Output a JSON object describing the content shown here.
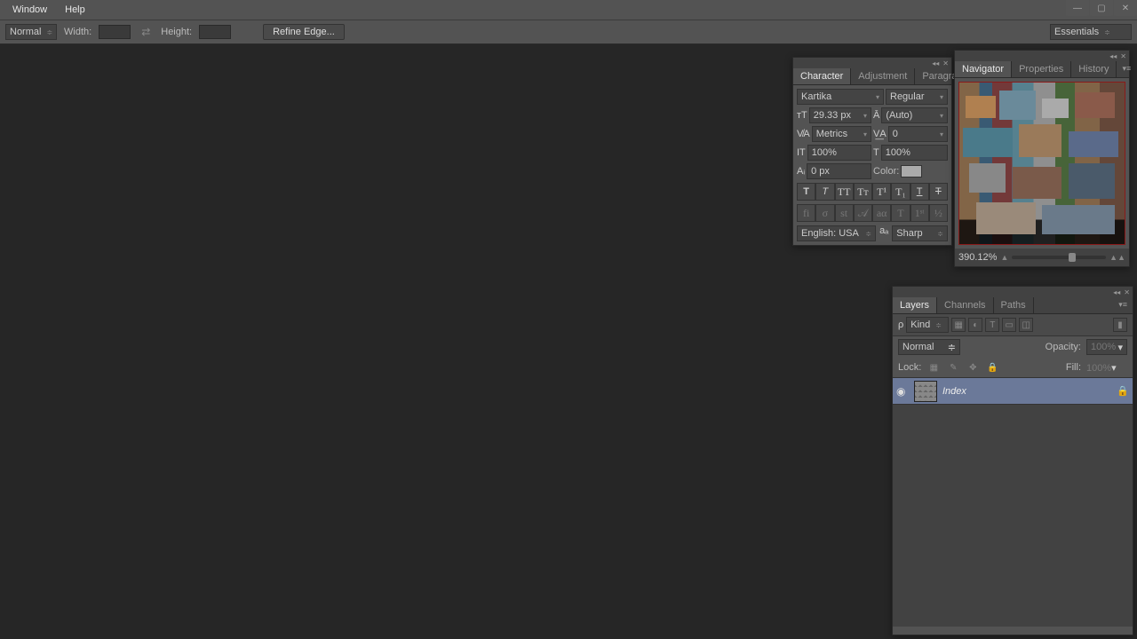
{
  "menu": {
    "window": "Window",
    "help": "Help"
  },
  "options": {
    "mode": "Normal",
    "width_label": "Width:",
    "height_label": "Height:",
    "refine": "Refine Edge...",
    "workspace": "Essentials"
  },
  "character": {
    "tabs": {
      "character": "Character",
      "adjustment": "Adjustment",
      "paragraph": "Paragraph"
    },
    "font": "Kartika",
    "weight": "Regular",
    "size": "29.33 px",
    "leading": "(Auto)",
    "kerning": "Metrics",
    "tracking": "0",
    "vscale": "100%",
    "hscale": "100%",
    "baseline": "0 px",
    "color_label": "Color:",
    "language": "English: USA",
    "aa": "Sharp"
  },
  "navigator": {
    "tabs": {
      "navigator": "Navigator",
      "properties": "Properties",
      "history": "History"
    },
    "zoom": "390.12%"
  },
  "layers": {
    "tabs": {
      "layers": "Layers",
      "channels": "Channels",
      "paths": "Paths"
    },
    "filter_kind": "Kind",
    "blend_mode": "Normal",
    "opacity_label": "Opacity:",
    "opacity_value": "100%",
    "lock_label": "Lock:",
    "fill_label": "Fill:",
    "fill_value": "100%",
    "items": [
      {
        "name": "Index"
      }
    ]
  }
}
